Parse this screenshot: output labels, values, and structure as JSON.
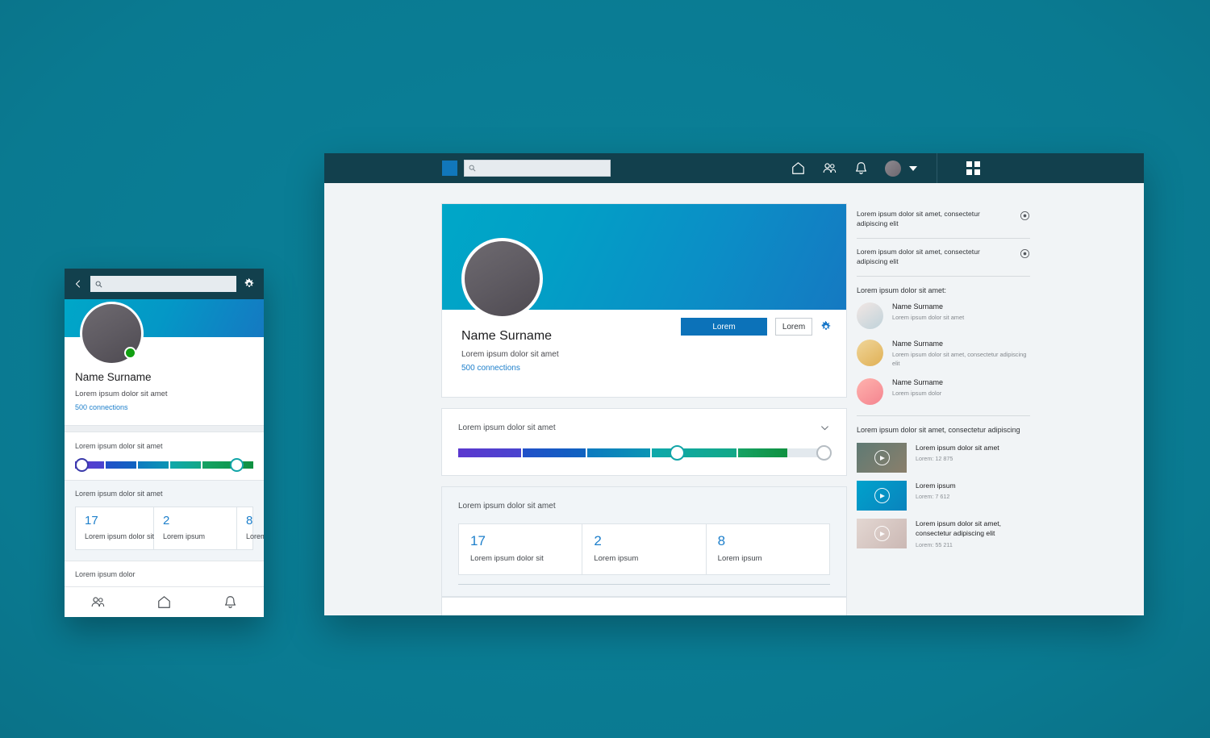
{
  "desktop": {
    "topbar": {
      "logo_icon": "app-logo",
      "search": {
        "value": "",
        "placeholder": "",
        "icon": "search-icon"
      },
      "icons": [
        "home-icon",
        "people-icon",
        "bell-icon",
        "avatar",
        "chevron-down-icon",
        "grid-apps-icon"
      ]
    },
    "profile": {
      "name": "Name Surname",
      "headline": "Lorem ipsum dolor sit amet",
      "connections": "500 connections",
      "primary_button": "Lorem",
      "secondary_button": "Lorem",
      "settings_icon": "gear-icon"
    },
    "slider_card": {
      "label": "Lorem ipsum dolor sit amet",
      "chevron_icon": "chevron-down-icon",
      "thumb1_percent": 57,
      "thumb2_percent": 98,
      "segment_colors": [
        "#5b38cf",
        "#1b55c4",
        "#0e7ec0",
        "#10a9a8",
        "#12a05c",
        "#0f9140"
      ],
      "track_rest_color": "#e3e9ee"
    },
    "stats_card": {
      "label": "Lorem ipsum dolor sit amet",
      "cells": [
        {
          "value": "17",
          "label": "Lorem ipsum dolor sit"
        },
        {
          "value": "2",
          "label": "Lorem ipsum"
        },
        {
          "value": "8",
          "label": "Lorem ipsum"
        }
      ]
    },
    "sidebar": {
      "notifications": [
        {
          "text": "Lorem ipsum dolor sit amet, consectetur adipiscing elit",
          "icon": "target-icon"
        },
        {
          "text": "Lorem ipsum dolor sit amet, consectetur adipiscing elit",
          "icon": "target-icon"
        }
      ],
      "contacts_heading": "Lorem ipsum dolor sit amet:",
      "contacts": [
        {
          "name": "Name Surname",
          "sub": "Lorem ipsum dolor sit amet",
          "avatar_color": "#cfd9de"
        },
        {
          "name": "Name Surname",
          "sub": "Lorem ipsum dolor sit amet, consectetur adipiscing elit",
          "avatar_color": "#e8bf74"
        },
        {
          "name": "Name Surname",
          "sub": "Lorem ipsum dolor",
          "avatar_color": "#f8919b"
        }
      ],
      "videos_heading": "Lorem ipsum dolor sit amet, consectetur adipiscing",
      "videos": [
        {
          "title": "Lorem ipsum dolor sit amet",
          "meta": "Lorem: 12 875",
          "thumb_color": "#6f7a6a",
          "play_icon": "play-icon"
        },
        {
          "title": "Lorem ipsum",
          "meta": "Lorem: 7 612",
          "thumb_color": "#0a94c4",
          "play_icon": "play-icon"
        },
        {
          "title": "Lorem ipsum dolor sit amet, consectetur adipiscing elit",
          "meta": "Lorem: 55 211",
          "thumb_color": "#d6c3bd",
          "play_icon": "play-icon"
        }
      ]
    }
  },
  "mobile": {
    "topbar": {
      "back_icon": "chevron-left-icon",
      "search": {
        "value": "",
        "placeholder": "",
        "icon": "search-icon"
      },
      "settings_icon": "gear-icon"
    },
    "profile": {
      "name": "Name Surname",
      "headline": "Lorem ipsum dolor sit amet",
      "connections": "500 connections",
      "status": "online"
    },
    "slider_card": {
      "label": "Lorem ipsum dolor sit amet",
      "thumb1_percent": 0,
      "thumb2_percent": 88
    },
    "stats_card": {
      "label": "Lorem ipsum dolor sit amet",
      "cells": [
        {
          "value": "17",
          "label": "Lorem ipsum dolor sit"
        },
        {
          "value": "2",
          "label": "Lorem ipsum"
        },
        {
          "value": "8",
          "label": "Lorem ipsum"
        }
      ]
    },
    "footer_label": "Lorem ipsum dolor",
    "nav": [
      "people-icon",
      "home-icon",
      "bell-icon"
    ]
  },
  "theme": {
    "background": "#0a7d95",
    "topbar": "#12404d",
    "accent_blue": "#0c72b9",
    "link_blue": "#1d7fcb",
    "cover_from": "#00a7c8",
    "cover_to": "#1579c2"
  }
}
